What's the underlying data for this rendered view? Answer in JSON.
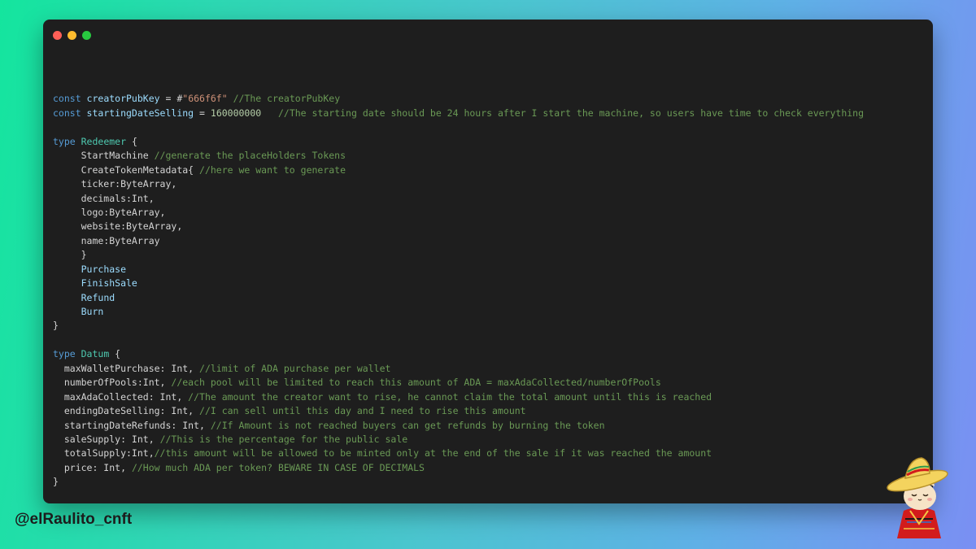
{
  "window": {
    "controls": [
      {
        "name": "close-window-button",
        "color": "#ff5f57"
      },
      {
        "name": "minimize-window-button",
        "color": "#febc2e"
      },
      {
        "name": "maximize-window-button",
        "color": "#28c840"
      }
    ]
  },
  "code": {
    "lines": [
      [],
      [
        {
          "t": "const ",
          "c": "kw"
        },
        {
          "t": "creatorPubKey",
          "c": "var"
        },
        {
          "t": " = #",
          "c": "punc"
        },
        {
          "t": "\"666f6f\"",
          "c": "str"
        },
        {
          "t": " //The creatorPubKey",
          "c": "cm"
        }
      ],
      [
        {
          "t": "const ",
          "c": "kw"
        },
        {
          "t": "startingDateSelling",
          "c": "var"
        },
        {
          "t": " = ",
          "c": "punc"
        },
        {
          "t": "160000000",
          "c": "num"
        },
        {
          "t": "   //The starting date should be 24 hours after I start the machine, so users have time to check everything",
          "c": "cm"
        }
      ],
      [],
      [
        {
          "t": "type ",
          "c": "kw"
        },
        {
          "t": "Redeemer",
          "c": "type"
        },
        {
          "t": " {",
          "c": "punc"
        }
      ],
      [
        {
          "t": "     StartMachine ",
          "c": "plain"
        },
        {
          "t": "//generate the placeHolders Tokens",
          "c": "cm"
        }
      ],
      [
        {
          "t": "     CreateTokenMetadata{ ",
          "c": "plain"
        },
        {
          "t": "//here we want to generate",
          "c": "cm"
        }
      ],
      [
        {
          "t": "     ticker:ByteArray,",
          "c": "plain"
        }
      ],
      [
        {
          "t": "     decimals:Int,",
          "c": "plain"
        }
      ],
      [
        {
          "t": "     logo:ByteArray,",
          "c": "plain"
        }
      ],
      [
        {
          "t": "     website:ByteArray,",
          "c": "plain"
        }
      ],
      [
        {
          "t": "     name:ByteArray",
          "c": "plain"
        }
      ],
      [
        {
          "t": "     }",
          "c": "punc"
        }
      ],
      [
        {
          "t": "     ",
          "c": "plain"
        },
        {
          "t": "Purchase",
          "c": "ctor"
        }
      ],
      [
        {
          "t": "     ",
          "c": "plain"
        },
        {
          "t": "FinishSale",
          "c": "ctor"
        }
      ],
      [
        {
          "t": "     ",
          "c": "plain"
        },
        {
          "t": "Refund",
          "c": "ctor"
        }
      ],
      [
        {
          "t": "     ",
          "c": "plain"
        },
        {
          "t": "Burn",
          "c": "ctor"
        }
      ],
      [
        {
          "t": "}",
          "c": "punc"
        }
      ],
      [],
      [
        {
          "t": "type ",
          "c": "kw"
        },
        {
          "t": "Datum",
          "c": "type"
        },
        {
          "t": " {",
          "c": "punc"
        }
      ],
      [
        {
          "t": "  maxWalletPurchase: Int, ",
          "c": "plain"
        },
        {
          "t": "//limit of ADA purchase per wallet",
          "c": "cm"
        }
      ],
      [
        {
          "t": "  numberOfPools:Int, ",
          "c": "plain"
        },
        {
          "t": "//each pool will be limited to reach this amount of ADA = maxAdaCollected/numberOfPools",
          "c": "cm"
        }
      ],
      [
        {
          "t": "  maxAdaCollected: Int, ",
          "c": "plain"
        },
        {
          "t": "//The amount the creator want to rise, he cannot claim the total amount until this is reached",
          "c": "cm"
        }
      ],
      [
        {
          "t": "  endingDateSelling: Int, ",
          "c": "plain"
        },
        {
          "t": "//I can sell until this day and I need to rise this amount",
          "c": "cm"
        }
      ],
      [
        {
          "t": "  startingDateRefunds: Int, ",
          "c": "plain"
        },
        {
          "t": "//If Amount is not reached buyers can get refunds by burning the token",
          "c": "cm"
        }
      ],
      [
        {
          "t": "  saleSupply: Int, ",
          "c": "plain"
        },
        {
          "t": "//This is the percentage for the public sale",
          "c": "cm"
        }
      ],
      [
        {
          "t": "  totalSupply:Int,",
          "c": "plain"
        },
        {
          "t": "//this amount will be allowed to be minted only at the end of the sale if it was reached the amount",
          "c": "cm"
        }
      ],
      [
        {
          "t": "  price: Int, ",
          "c": "plain"
        },
        {
          "t": "//How much ADA per token? BEWARE IN CASE OF DECIMALS",
          "c": "cm"
        }
      ],
      [
        {
          "t": "}",
          "c": "punc"
        }
      ]
    ]
  },
  "footer": {
    "handle": "@elRaulito_cnft"
  },
  "mascot": {
    "icon": "cat-with-sombrero-icon"
  }
}
